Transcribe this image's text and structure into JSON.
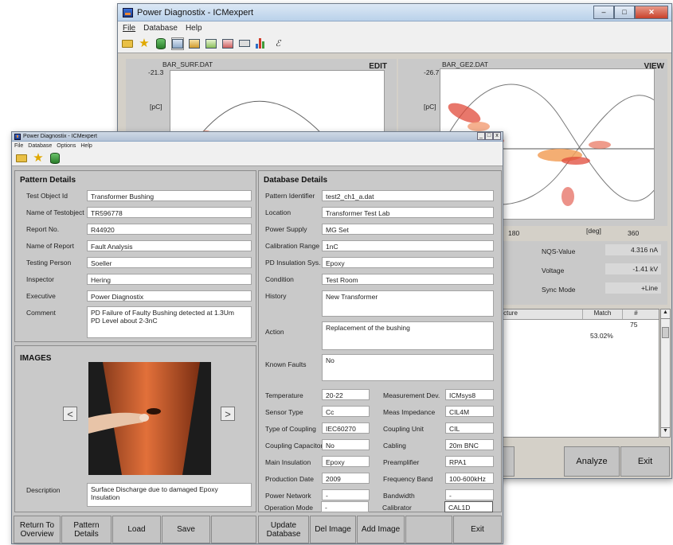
{
  "back": {
    "title": "Power Diagnostix - ICMexpert",
    "menu": [
      "File",
      "Database",
      "Help"
    ],
    "left_plot": {
      "file": "BAR_SURF.DAT",
      "ymax": "-21.3",
      "unit": "[pC]",
      "mode": "EDIT"
    },
    "right_plot": {
      "file": "BAR_GE2.DAT",
      "ymax": "-26.7",
      "unit": "[pC]",
      "mode": "VIEW",
      "x_ticks": [
        "180",
        "[deg]",
        "360"
      ]
    },
    "nqs_label": "NQS-Value",
    "nqs_value": "4.316 nA",
    "voltage_label": "Voltage",
    "voltage_value": "-1.41 kV",
    "sync_label": "Sync Mode",
    "sync_value": "+Line",
    "table_headers": [
      "ructure",
      "Match",
      "#"
    ],
    "table_match": "53.02%",
    "table_count": "75",
    "analyze": "Analyze",
    "exit": "Exit"
  },
  "front": {
    "title": "Power Diagnostix - ICMexpert",
    "menu": [
      "File",
      "Database",
      "Options",
      "Help"
    ],
    "pattern": {
      "heading": "Pattern Details",
      "fields": [
        {
          "label": "Test Object Id",
          "value": "Transformer Bushing"
        },
        {
          "label": "Name of Testobject",
          "value": "TR596778"
        },
        {
          "label": "Report No.",
          "value": "R44920"
        },
        {
          "label": "Name of Report",
          "value": "Fault Analysis"
        },
        {
          "label": "Testing Person",
          "value": "Soeller"
        },
        {
          "label": "Inspector",
          "value": "Hering"
        },
        {
          "label": "Executive",
          "value": "Power Diagnostix"
        }
      ],
      "comment_label": "Comment",
      "comment": "PD Failure of Faulty Bushing detected at 1.3Um\nPD Level about 2-3nC"
    },
    "images": {
      "heading": "IMAGES",
      "prev": "<",
      "next": ">",
      "desc_label": "Description",
      "desc": "Surface Discharge due to damaged Epoxy Insulation"
    },
    "database": {
      "heading": "Database Details",
      "fields": [
        {
          "label": "Pattern Identifier",
          "value": "test2_ch1_a.dat"
        },
        {
          "label": "Location",
          "value": "Transformer Test Lab"
        },
        {
          "label": "Power Supply",
          "value": "MG Set"
        },
        {
          "label": "Calibration Range",
          "value": "1nC"
        },
        {
          "label": "PD Insulation Sys.",
          "value": "Epoxy"
        },
        {
          "label": "Condition",
          "value": "Test Room"
        }
      ],
      "history_label": "History",
      "history": "New Transformer",
      "action_label": "Action",
      "action": "Replacement of the bushing",
      "faults_label": "Known Faults",
      "faults": "No",
      "left_grid": [
        {
          "label": "Temperature",
          "value": "20-22"
        },
        {
          "label": "Sensor Type",
          "value": "Cc"
        },
        {
          "label": "Type of Coupling",
          "value": "IEC60270"
        },
        {
          "label": "Coupling Capacitor",
          "value": "No"
        },
        {
          "label": "Main Insulation",
          "value": "Epoxy"
        },
        {
          "label": "Production Date",
          "value": "2009"
        },
        {
          "label": "Power Network",
          "value": "-"
        },
        {
          "label": "Operation Mode",
          "value": "-"
        }
      ],
      "right_grid": [
        {
          "label": "Measurement Dev.",
          "value": "ICMsys8"
        },
        {
          "label": "Meas Impedance",
          "value": "CIL4M"
        },
        {
          "label": "Coupling Unit",
          "value": "CIL"
        },
        {
          "label": "Cabling",
          "value": "20m BNC"
        },
        {
          "label": "Preamplifier",
          "value": "RPA1"
        },
        {
          "label": "Frequency Band",
          "value": "100-600kHz"
        },
        {
          "label": "Bandwidth",
          "value": "-"
        },
        {
          "label": "Calibrator",
          "value": "CAL1D"
        }
      ]
    },
    "buttons": {
      "return": "Return To Overview",
      "pattern": "Pattern Details",
      "load": "Load",
      "save": "Save",
      "update": "Update Database",
      "del": "Del Image",
      "add": "Add Image",
      "exit": "Exit"
    }
  }
}
